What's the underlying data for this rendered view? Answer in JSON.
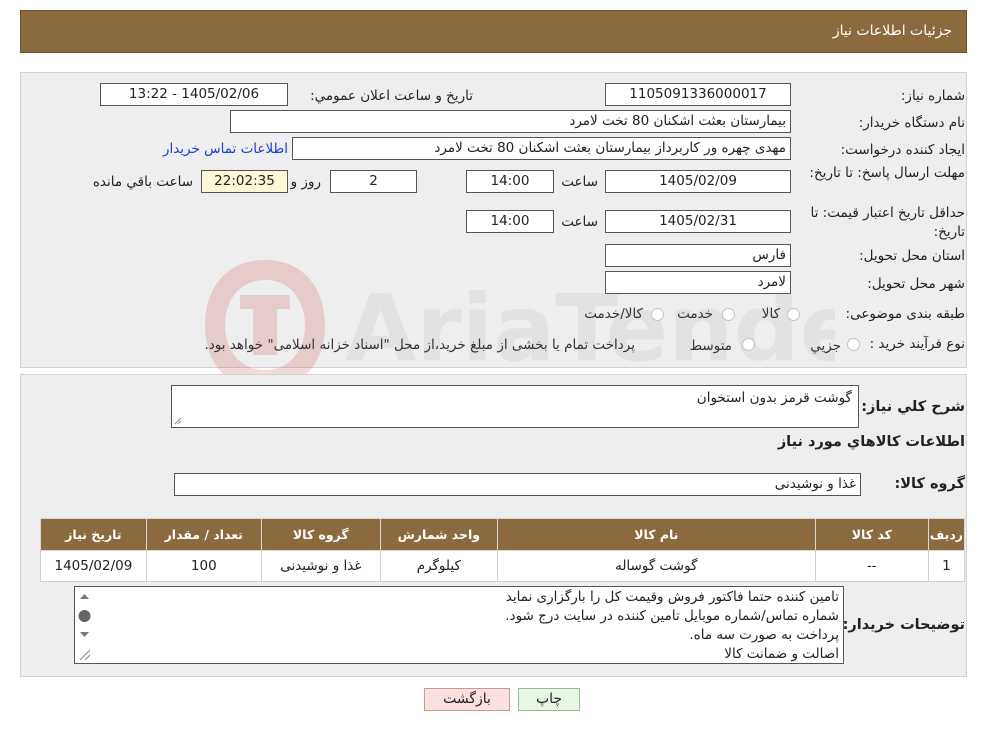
{
  "header": {
    "title": "جزئيات اطلاعات نياز"
  },
  "form": {
    "need_number_label": "شماره نياز:",
    "need_number": "1105091336000017",
    "announce_label": "تاريخ و ساعت اعلان عمومي:",
    "announce_value": "1405/02/06 - 13:22",
    "buyer_org_label": "نام دستگاه خريدار:",
    "buyer_org": "بیمارستان بعثت اشکنان 80 تخت لامرد",
    "creator_label": "ايجاد کننده درخواست:",
    "creator": "مهدی چهره ور کاربرداز بیمارستان بعثت اشکنان 80 تخت لامرد",
    "contact_link": "اطلاعات تماس خريدار",
    "deadline_label": "مهلت ارسال پاسخ: تا تاريخ:",
    "deadline_date": "1405/02/09",
    "time_label": "ساعت",
    "deadline_time": "14:00",
    "days_value": "2",
    "days_label": "روز و",
    "remaining_time": "22:02:35",
    "remaining_label": "ساعت باقي مانده",
    "validity_label": "حداقل تاريخ اعتبار قيمت: تا تاريخ:",
    "validity_date": "1405/02/31",
    "validity_time": "14:00",
    "province_label": "استان محل تحويل:",
    "province": "فارس",
    "city_label": "شهر محل تحويل:",
    "city": "لامرد",
    "category_label": "طبقه بندی موضوعی:",
    "category_options": [
      "کالا",
      "خدمت",
      "کالا/خدمت"
    ],
    "process_label": "نوع فرآيند خريد :",
    "process_options": [
      "جزيي",
      "متوسط"
    ],
    "process_note": "پرداخت تمام يا بخشی از مبلغ خريد،از محل \"اسناد خزانه اسلامی\" خواهد بود."
  },
  "detail": {
    "description_label": "شرح کلي نياز:",
    "description": "گوشت قرمز بدون استخوان",
    "goods_info_title": "اطلاعات کالاهاي مورد نياز",
    "goods_group_label": "گروه کالا:",
    "goods_group": "غذا و نوشیدنی",
    "table": {
      "headers": [
        "رديف",
        "کد کالا",
        "نام کالا",
        "واحد شمارش",
        "گروه کالا",
        "تعداد / مقدار",
        "تاريخ نياز"
      ],
      "rows": [
        [
          "1",
          "--",
          "گوشت گوساله",
          "کیلوگرم",
          "غذا و نوشیدنی",
          "100",
          "1405/02/09"
        ]
      ]
    },
    "buyer_notes_label": "توضيحات خريدار:",
    "buyer_notes": [
      "تامین کننده حتما فاکتور فروش وقیمت کل را بارگزاری نماید",
      "شماره تماس/شماره  موبایل تامین کننده در سایت درج شود.",
      "پرداخت به صورت سه ماه.",
      "اصالت و ضمانت کالا"
    ]
  },
  "buttons": {
    "print": "چاپ",
    "back": "بازگشت"
  },
  "colors": {
    "header_brown": "#8b6b3e",
    "panel_gray": "#eeeeee",
    "link_blue": "#1a3fd0",
    "back_pink": "#fbe0e0",
    "print_green": "#e8f6e4",
    "yellow_box": "#fbf8d6"
  },
  "icons": [
    "aria-tender-watermark",
    "radio-icon",
    "resize-handle-icon",
    "scroll-up-icon",
    "scroll-down-icon",
    "scroll-thumb-icon"
  ]
}
